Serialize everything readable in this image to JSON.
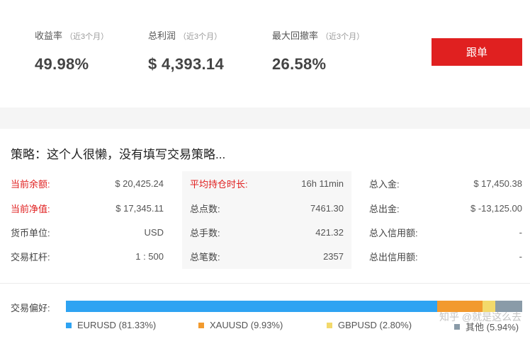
{
  "stats": [
    {
      "label": "收益率",
      "hint": "（近3个月）",
      "value": "49.98%"
    },
    {
      "label": "总利润",
      "hint": "（近3个月）",
      "value": "$ 4,393.14"
    },
    {
      "label": "最大回撤率",
      "hint": "（近3个月）",
      "value": "26.58%"
    }
  ],
  "follow_button": "跟单",
  "strategy": "策略：这个人很懒，没有填写交易策略...",
  "info": {
    "left": [
      {
        "key": "当前余额:",
        "value": "$ 20,425.24"
      },
      {
        "key": "当前净值:",
        "value": "$ 17,345.11"
      },
      {
        "key": "货币单位:",
        "value": "USD"
      },
      {
        "key": "交易杠杆:",
        "value": "1 : 500"
      }
    ],
    "middle": [
      {
        "key": "平均持仓时长:",
        "value": "16h 11min"
      },
      {
        "key": "总点数:",
        "value": "7461.30"
      },
      {
        "key": "总手数:",
        "value": "421.32"
      },
      {
        "key": "总笔数:",
        "value": "2357"
      }
    ],
    "right": [
      {
        "key": "总入金:",
        "value": "$ 17,450.38"
      },
      {
        "key": "总出金:",
        "value": "$ -13,125.00"
      },
      {
        "key": "总入信用额:",
        "value": "-"
      },
      {
        "key": "总出信用额:",
        "value": "-"
      }
    ]
  },
  "preference": {
    "label": "交易偏好:",
    "items": [
      {
        "name": "EURUSD (81.33%)",
        "share": 81.33,
        "color": "#2ea3f2"
      },
      {
        "name": "XAUUSD (9.93%)",
        "share": 9.93,
        "color": "#f29a2e"
      },
      {
        "name": "GBPUSD (2.80%)",
        "share": 2.8,
        "color": "#f3d96b"
      },
      {
        "name": "其他 (5.94%)",
        "share": 5.94,
        "color": "#8a9ba8"
      }
    ]
  },
  "watermark": "知乎 @就是这么去",
  "colors": {
    "accent": "#e02020",
    "panel": "#f7f7f7"
  }
}
